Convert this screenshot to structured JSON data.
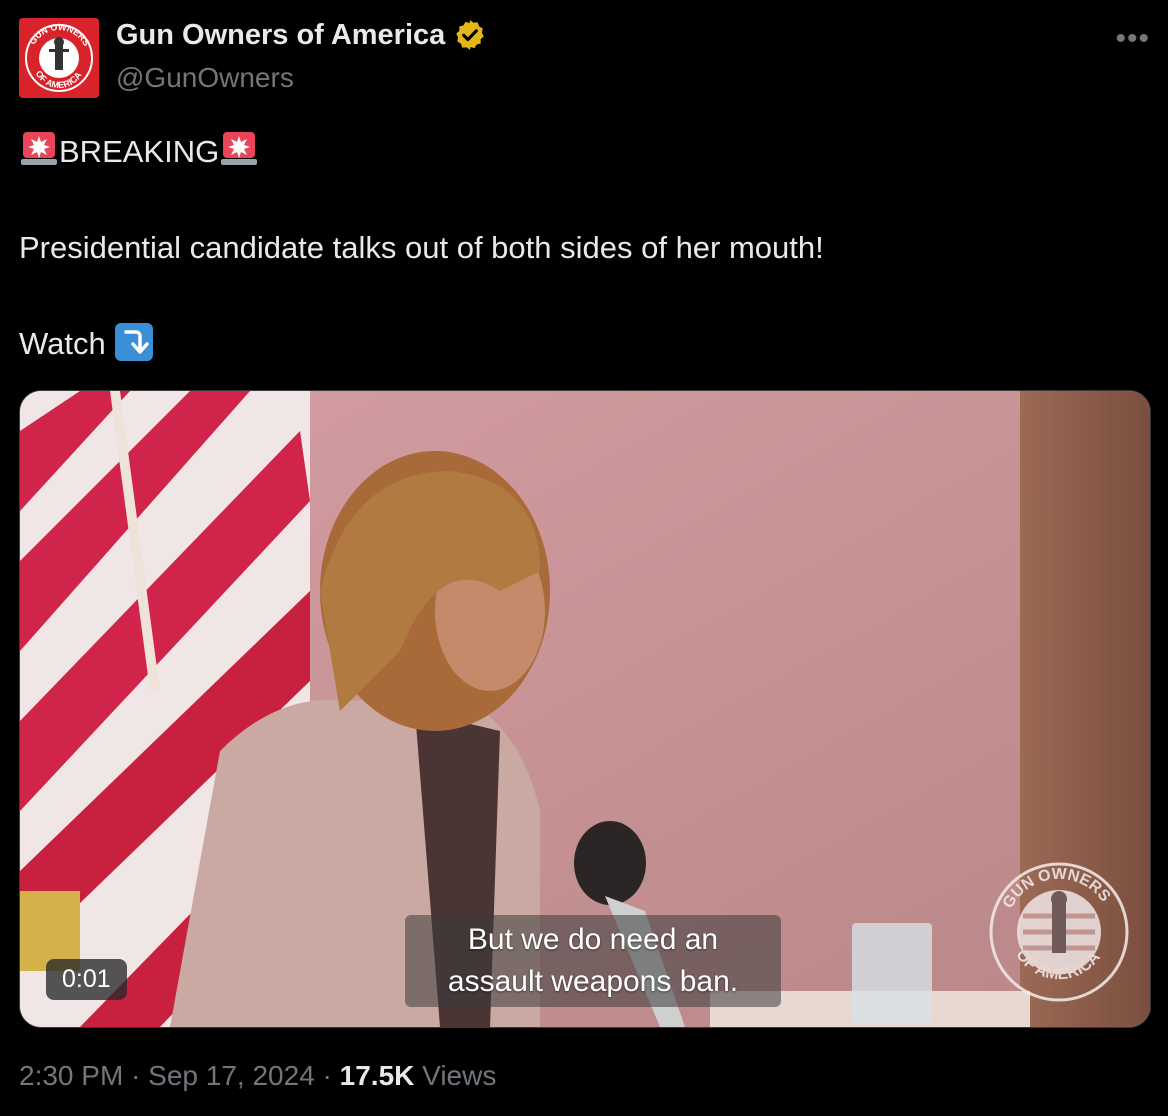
{
  "author": {
    "display_name": "Gun Owners of America",
    "handle": "@GunOwners",
    "avatar_icon": "gun-owners-of-america-logo",
    "verified": true,
    "verified_color": "#e2b719"
  },
  "more_label": "•••",
  "tweet": {
    "breaking_label": "BREAKING",
    "body": "Presidential candidate talks out of both sides of her mouth!",
    "watch_label": "Watch"
  },
  "media": {
    "duration": "0:01",
    "caption_line1": "But we do need an",
    "caption_line2": "assault weapons ban."
  },
  "meta": {
    "time": "2:30 PM",
    "sep1": " · ",
    "date": "Sep 17, 2024",
    "sep2": " · ",
    "views_count": "17.5K",
    "views_label": " Views"
  }
}
